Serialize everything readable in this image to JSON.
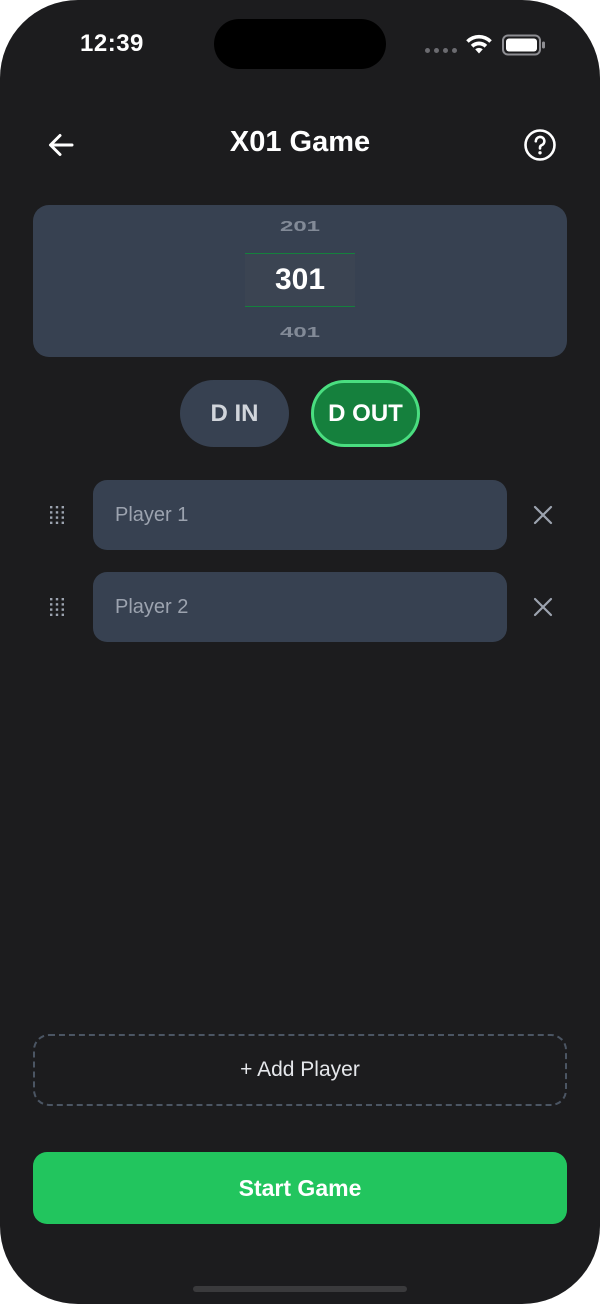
{
  "status_bar": {
    "time": "12:39",
    "icons": [
      "signal-dots-icon",
      "wifi-icon",
      "battery-icon"
    ]
  },
  "header": {
    "title": "X01 Game",
    "back_icon": "arrow-left-icon",
    "help_icon": "question-circle-icon"
  },
  "score_picker": {
    "previous": "201",
    "selected": "301",
    "next": "401"
  },
  "toggles": {
    "double_in": {
      "label": "D IN",
      "active": false
    },
    "double_out": {
      "label": "D OUT",
      "active": true
    }
  },
  "players": [
    {
      "placeholder": "Player 1",
      "value": ""
    },
    {
      "placeholder": "Player 2",
      "value": ""
    }
  ],
  "add_player_label": "+ Add Player",
  "start_game_label": "Start Game",
  "colors": {
    "background": "#1c1c1e",
    "card": "#374151",
    "accent_green": "#22c55e",
    "active_toggle": "#15803d",
    "active_toggle_border": "#4ade80"
  }
}
